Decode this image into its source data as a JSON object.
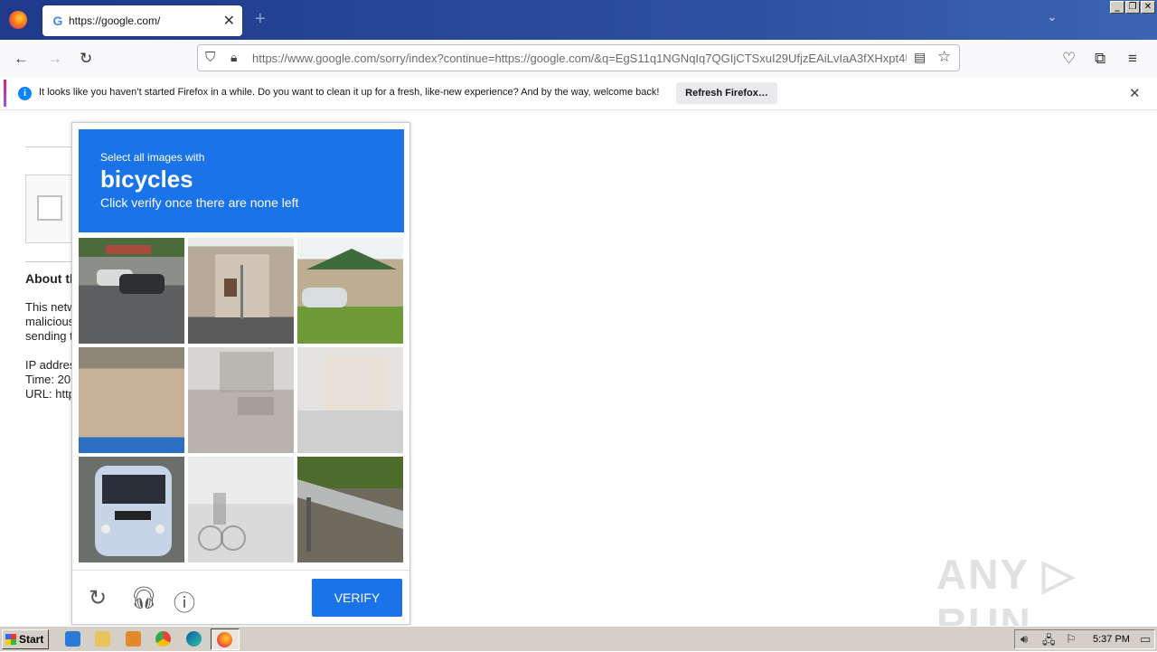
{
  "browser": {
    "tab_title": "https://google.com/",
    "tab_favicon": "G",
    "tab_close": "✕",
    "new_tab": "+",
    "url": "https://www.google.com/sorry/index?continue=https://google.com/&q=EgS11q1NGNqIq7QGIjCTSxuI29UfjzEAiLvIaA3fXHxpt4U",
    "window_buttons": [
      "_",
      "❐",
      "✕"
    ]
  },
  "infobar": {
    "message": "It looks like you haven’t started Firefox in a while. Do you want to clean it up for a fresh, like-new experience? And by the way, welcome back!",
    "button": "Refresh Firefox…",
    "close": "✕"
  },
  "page": {
    "about_heading": "About th",
    "para_lines": [
      "This netw",
      "malicious",
      "sending t"
    ],
    "ip_line": "IP addres",
    "time_line": "Time: 20",
    "url_line": "URL: http"
  },
  "captcha": {
    "instruction_top": "Select all images with",
    "target": "bicycles",
    "instruction_bottom": "Click verify once there are none left",
    "verify_label": "VERIFY",
    "tiles": [
      "parking-lot-cars",
      "house-street",
      "house-car-grass",
      "dirt-road",
      "faded-street",
      "faded-house",
      "bus",
      "faded-cyclist",
      "guardrail"
    ]
  },
  "watermark": "ANY ▷ RUN",
  "taskbar": {
    "start_label": "Start",
    "clock": "5:37 PM"
  },
  "colors": {
    "captcha_blue": "#1a73e8",
    "titlebar_blue": "#1f3a8a"
  }
}
